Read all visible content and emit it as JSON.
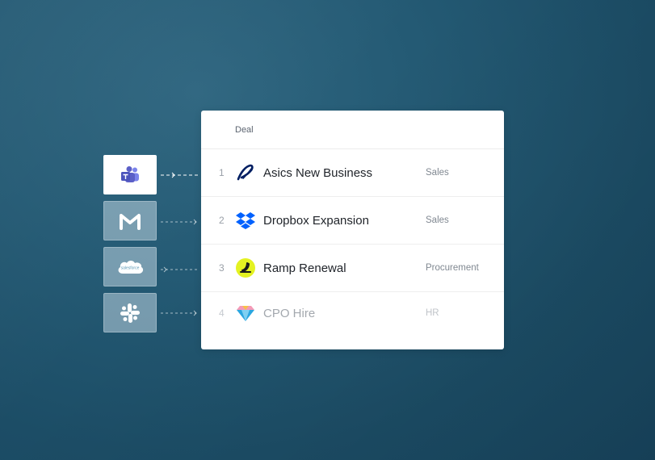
{
  "sources": [
    {
      "name": "microsoft-teams",
      "icon": "teams-icon",
      "state": "active"
    },
    {
      "name": "gmail",
      "icon": "gmail-icon",
      "state": "inactive"
    },
    {
      "name": "salesforce",
      "icon": "salesforce-icon",
      "label": "salesforce",
      "state": "inactive"
    },
    {
      "name": "slack",
      "icon": "slack-icon",
      "state": "inactive"
    }
  ],
  "table": {
    "header": "Deal",
    "rows": [
      {
        "num": "1",
        "name": "Asics New Business",
        "category": "Sales",
        "logo": "asics-logo"
      },
      {
        "num": "2",
        "name": "Dropbox Expansion",
        "category": "Sales",
        "logo": "dropbox-logo"
      },
      {
        "num": "3",
        "name": "Ramp Renewal",
        "category": "Procurement",
        "logo": "ramp-logo"
      },
      {
        "num": "4",
        "name": "CPO Hire",
        "category": "HR",
        "logo": "gem-logo"
      }
    ]
  },
  "colors": {
    "teams": "#5b5fc7",
    "dropbox": "#0061fe",
    "asics": "#001e62",
    "ramp": "#e4f222"
  }
}
